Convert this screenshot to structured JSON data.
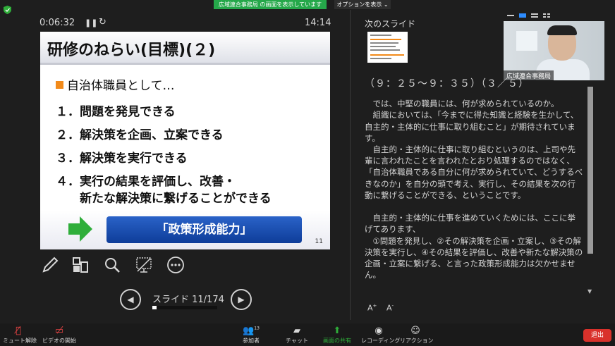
{
  "top": {
    "share_banner": "広域連合事務局 の画面を表示しています",
    "view_options": "オプションを表示 ⌄",
    "right_hint": "表示"
  },
  "presenter": {
    "timer": "0:06:32",
    "clock": "14:14",
    "slide_counter": "スライド 11/174",
    "progress_fraction": 0.063
  },
  "slide": {
    "title": "研修のねらい(目標)(２)",
    "subtitle": "自治体職員として…",
    "items": [
      "１．問題を発見できる",
      "２．解決策を企画、立案できる",
      "３．解決策を実行できる",
      "４．実行の結果を評価し、改善・",
      "　　新たな解決策に繋げることができる"
    ],
    "banner": "「政策形成能力」",
    "page_number": "11",
    "accent_color": "#f28a1a",
    "banner_color": "#1a4fb0",
    "arrow_color": "#2fae3a"
  },
  "next": {
    "label": "次のスライド"
  },
  "video": {
    "name": "広域連合事務局"
  },
  "notes": {
    "timing": "（９：２５～９：３５）（３／５）",
    "text": "　では、中堅の職員には、何が求められているのか。\n　組織においては、「今までに得た知識と経験を生かして、自主的・主体的に仕事に取り組むこと」が期待されています。\n　自主的・主体的に仕事に取り組むというのは、上司や先輩に言われたことを言われたとおり処理するのではなく、「自治体職員である自分に何が求められていて、どうするべきなのか」を自分の頭で考え、実行し、その結果を次の行動に繋げることができる、ということです。\n\n　自主的・主体的に仕事を進めていくためには、ここに挙げてあります、\n　①問題を発見し、②その解決策を企画・立案し、③その解決策を実行し、④その結果を評価し、改善や新たな解決策の企画・立案に繋げる、と言った政策形成能力は欠かせません。"
  },
  "toolbar": {
    "mute": "ミュート解除",
    "video": "ビデオの開始",
    "participants": "参加者",
    "participants_count": "13",
    "chat": "チャット",
    "share": "画面の共有",
    "record": "レコーディング",
    "reactions": "リアクション",
    "end": "退出"
  }
}
